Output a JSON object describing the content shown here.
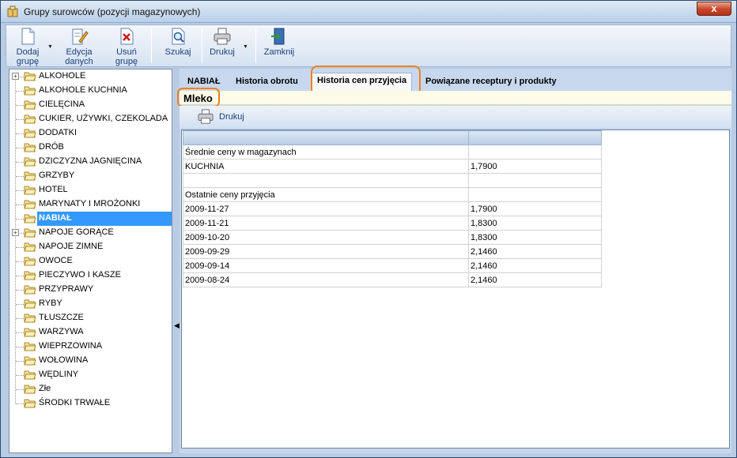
{
  "window": {
    "title": "Grupy surowców (pozycji magazynowych)",
    "close_glyph": "x"
  },
  "toolbar": {
    "add_label_1": "Dodaj",
    "add_label_2": "grupę",
    "edit_label_1": "Edycja",
    "edit_label_2": "danych",
    "delete_label_1": "Usuń",
    "delete_label_2": "grupę",
    "search_label": "Szukaj",
    "print_label": "Drukuj",
    "close_label": "Zamknij"
  },
  "tree": {
    "items": [
      {
        "label": "ALKOHOLE",
        "expandable": true
      },
      {
        "label": "ALKOHOLE KUCHNIA"
      },
      {
        "label": "CIELĘCINA"
      },
      {
        "label": "CUKIER, UŻYWKI, CZEKOLADA"
      },
      {
        "label": "DODATKI"
      },
      {
        "label": "DRÓB"
      },
      {
        "label": "DZICZYZNA JAGNIĘCINA"
      },
      {
        "label": "GRZYBY"
      },
      {
        "label": "HOTEL"
      },
      {
        "label": "MARYNATY I MROŻONKI"
      },
      {
        "label": "NABIAŁ",
        "selected": true
      },
      {
        "label": "NAPOJE GORĄCE",
        "expandable": true
      },
      {
        "label": "NAPOJE ZIMNE"
      },
      {
        "label": "OWOCE"
      },
      {
        "label": "PIECZYWO I KASZE"
      },
      {
        "label": "PRZYPRAWY"
      },
      {
        "label": "RYBY"
      },
      {
        "label": "TŁUSZCZE"
      },
      {
        "label": "WARZYWA"
      },
      {
        "label": "WIEPRZOWINA"
      },
      {
        "label": "WOŁOWINA"
      },
      {
        "label": "WĘDLINY"
      },
      {
        "label": "Złe"
      },
      {
        "label": "ŚRODKI TRWAŁE"
      }
    ]
  },
  "tabs": [
    {
      "label": "NABIAŁ"
    },
    {
      "label": "Historia obrotu"
    },
    {
      "label": "Historia cen przyjęcia",
      "active": true
    },
    {
      "label": "Powiązane receptury i produkty"
    }
  ],
  "product": {
    "name": "Mleko"
  },
  "sub_toolbar": {
    "print_label": "Drukuj"
  },
  "grid": {
    "rows": [
      [
        "Średnie ceny w magazynach",
        ""
      ],
      [
        "KUCHNIA",
        "1,7900"
      ],
      [
        "",
        ""
      ],
      [
        "Ostatnie ceny przyjęcia",
        ""
      ],
      [
        "2009-11-27",
        "1,7900"
      ],
      [
        "2009-11-21",
        "1,8300"
      ],
      [
        "2009-10-20",
        "1,8300"
      ],
      [
        "2009-09-29",
        "2,1460"
      ],
      [
        "2009-09-14",
        "2,1460"
      ],
      [
        "2009-08-24",
        "2,1460"
      ]
    ]
  },
  "colors": {
    "highlight": "#f08020",
    "selection": "#3399ff"
  }
}
